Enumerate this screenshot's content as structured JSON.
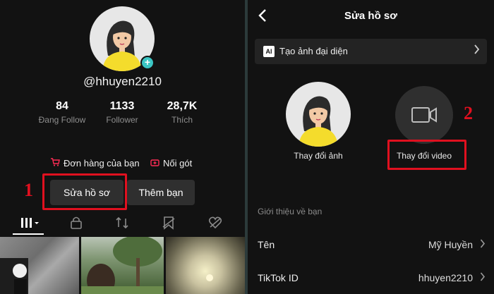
{
  "profile": {
    "username": "@hhuyen2210",
    "stats": [
      {
        "value": "84",
        "label": "Đang Follow"
      },
      {
        "value": "1133",
        "label": "Follower"
      },
      {
        "value": "28,7K",
        "label": "Thích"
      }
    ],
    "orders_label": "Đơn hàng của bạn",
    "wishlist_label": "Nối gót",
    "edit_profile_label": "Sửa hồ sơ",
    "add_friends_label": "Thêm bạn"
  },
  "annotations": {
    "step1": "1",
    "step2": "2"
  },
  "edit_screen": {
    "title": "Sửa hồ sơ",
    "ai_badge": "AI",
    "ai_label": "Tạo ảnh đại diện",
    "change_photo_label": "Thay đổi ảnh",
    "change_video_label": "Thay đổi video",
    "about_section": "Giới thiệu về bạn",
    "name_label": "Tên",
    "name_value": "Mỹ Huyền",
    "tiktok_id_label": "TikTok ID",
    "tiktok_id_value": "hhuyen2210"
  },
  "colors": {
    "accent": "#fe2c55",
    "highlight_red": "#e0101f",
    "badge_teal": "#3bc6c4",
    "avatar_shirt": "#f4dc2c"
  }
}
